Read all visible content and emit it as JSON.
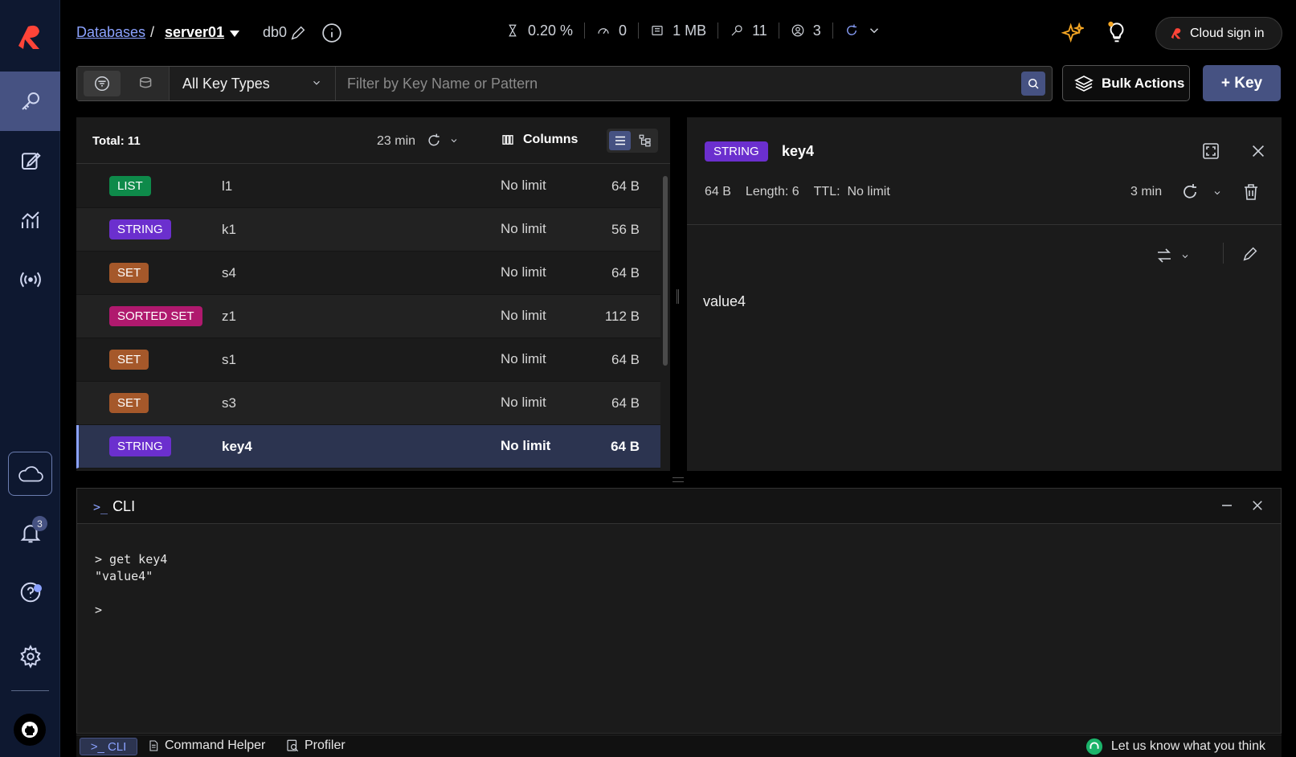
{
  "breadcrumb": {
    "databases": "Databases",
    "separator": "/",
    "server": "server01",
    "db": "db0"
  },
  "stats": {
    "cpu": "0.20 %",
    "ops": "0",
    "memory": "1 MB",
    "keys": "11",
    "clients": "3"
  },
  "header": {
    "cloud_sign_in": "Cloud sign in"
  },
  "filter": {
    "key_type": "All Key Types",
    "placeholder": "Filter by Key Name or Pattern"
  },
  "actions": {
    "bulk": "Bulk Actions",
    "add_key": "+ Key"
  },
  "keylist": {
    "total": "Total: 11",
    "refresh_time": "23 min",
    "columns_label": "Columns",
    "rows": [
      {
        "type": "LIST",
        "color": "#0e8a4a",
        "name": "l1",
        "ttl": "No limit",
        "size": "64 B"
      },
      {
        "type": "STRING",
        "color": "#6b2fce",
        "name": "k1",
        "ttl": "No limit",
        "size": "56 B"
      },
      {
        "type": "SET",
        "color": "#a5582a",
        "name": "s4",
        "ttl": "No limit",
        "size": "64 B"
      },
      {
        "type": "SORTED SET",
        "color": "#b0196e",
        "name": "z1",
        "ttl": "No limit",
        "size": "112 B"
      },
      {
        "type": "SET",
        "color": "#a5582a",
        "name": "s1",
        "ttl": "No limit",
        "size": "64 B"
      },
      {
        "type": "SET",
        "color": "#a5582a",
        "name": "s3",
        "ttl": "No limit",
        "size": "64 B"
      },
      {
        "type": "STRING",
        "color": "#6b2fce",
        "name": "key4",
        "ttl": "No limit",
        "size": "64 B"
      }
    ]
  },
  "detail": {
    "type": "STRING",
    "key": "key4",
    "size": "64 B",
    "length": "Length: 6",
    "ttl_label": "TTL:",
    "ttl": "No limit",
    "refresh_time": "3 min",
    "value": "value4"
  },
  "cli": {
    "prompt_icon": ">_",
    "title": "CLI",
    "line1": "> get key4",
    "line2": "\"value4\"",
    "prompt": ">"
  },
  "bottombar": {
    "cli": ">_ CLI",
    "command_helper": "Command Helper",
    "profiler": "Profiler",
    "feedback": "Let us know what you think"
  },
  "notifications": {
    "count": "3"
  }
}
